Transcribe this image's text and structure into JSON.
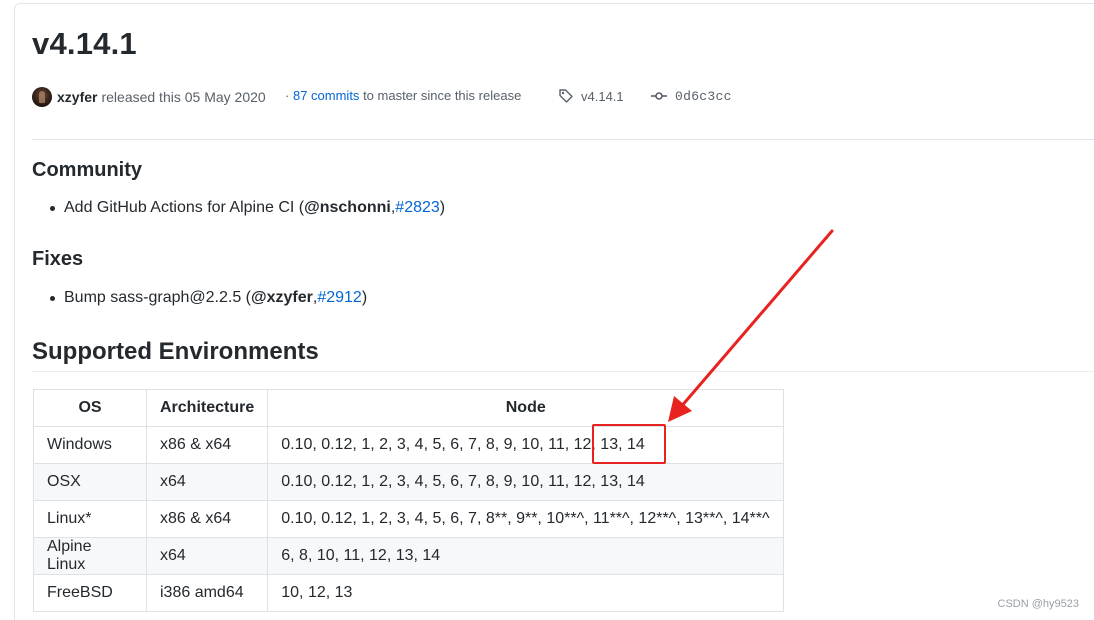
{
  "release": {
    "title": "v4.14.1",
    "author": "xzyfer",
    "released_text": "released this 05 May 2020",
    "commits_prefix": "·",
    "commits_count": "87 commits",
    "commits_suffix": "to master since this release",
    "tag": "v4.14.1",
    "commit_sha": "0d6c3cc"
  },
  "community": {
    "heading": "Community",
    "item_text": "Add GitHub Actions for Alpine CI (",
    "item_user": "@nschonni",
    "item_sep": ", ",
    "item_link": "#2823",
    "item_close": ")"
  },
  "fixes": {
    "heading": "Fixes",
    "item_text": "Bump sass-graph@2.2.5 (",
    "item_user": "@xzyfer",
    "item_sep": ", ",
    "item_link": "#2912",
    "item_close": ")"
  },
  "environments": {
    "heading": "Supported Environments",
    "headers": [
      "OS",
      "Architecture",
      "Node"
    ],
    "rows": [
      [
        "Windows",
        "x86 & x64",
        "0.10, 0.12, 1, 2, 3, 4, 5, 6, 7, 8, 9, 10, 11, 12, 13, 14"
      ],
      [
        "OSX",
        "x64",
        "0.10, 0.12, 1, 2, 3, 4, 5, 6, 7, 8, 9, 10, 11, 12, 13, 14"
      ],
      [
        "Linux*",
        "x86 & x64",
        "0.10, 0.12, 1, 2, 3, 4, 5, 6, 7, 8**, 9**, 10**^, 11**^, 12**^, 13**^, 14**^"
      ],
      [
        "Alpine Linux",
        "x64",
        "6, 8, 10, 11, 12, 13, 14"
      ],
      [
        "FreeBSD",
        "i386 amd64",
        "10, 12, 13"
      ]
    ]
  },
  "annotation": {
    "color": "#e8231f"
  },
  "watermark": "CSDN @hy9523",
  "icons": {
    "tag": "tag-icon",
    "commit": "git-commit-icon",
    "avatar": "avatar"
  }
}
